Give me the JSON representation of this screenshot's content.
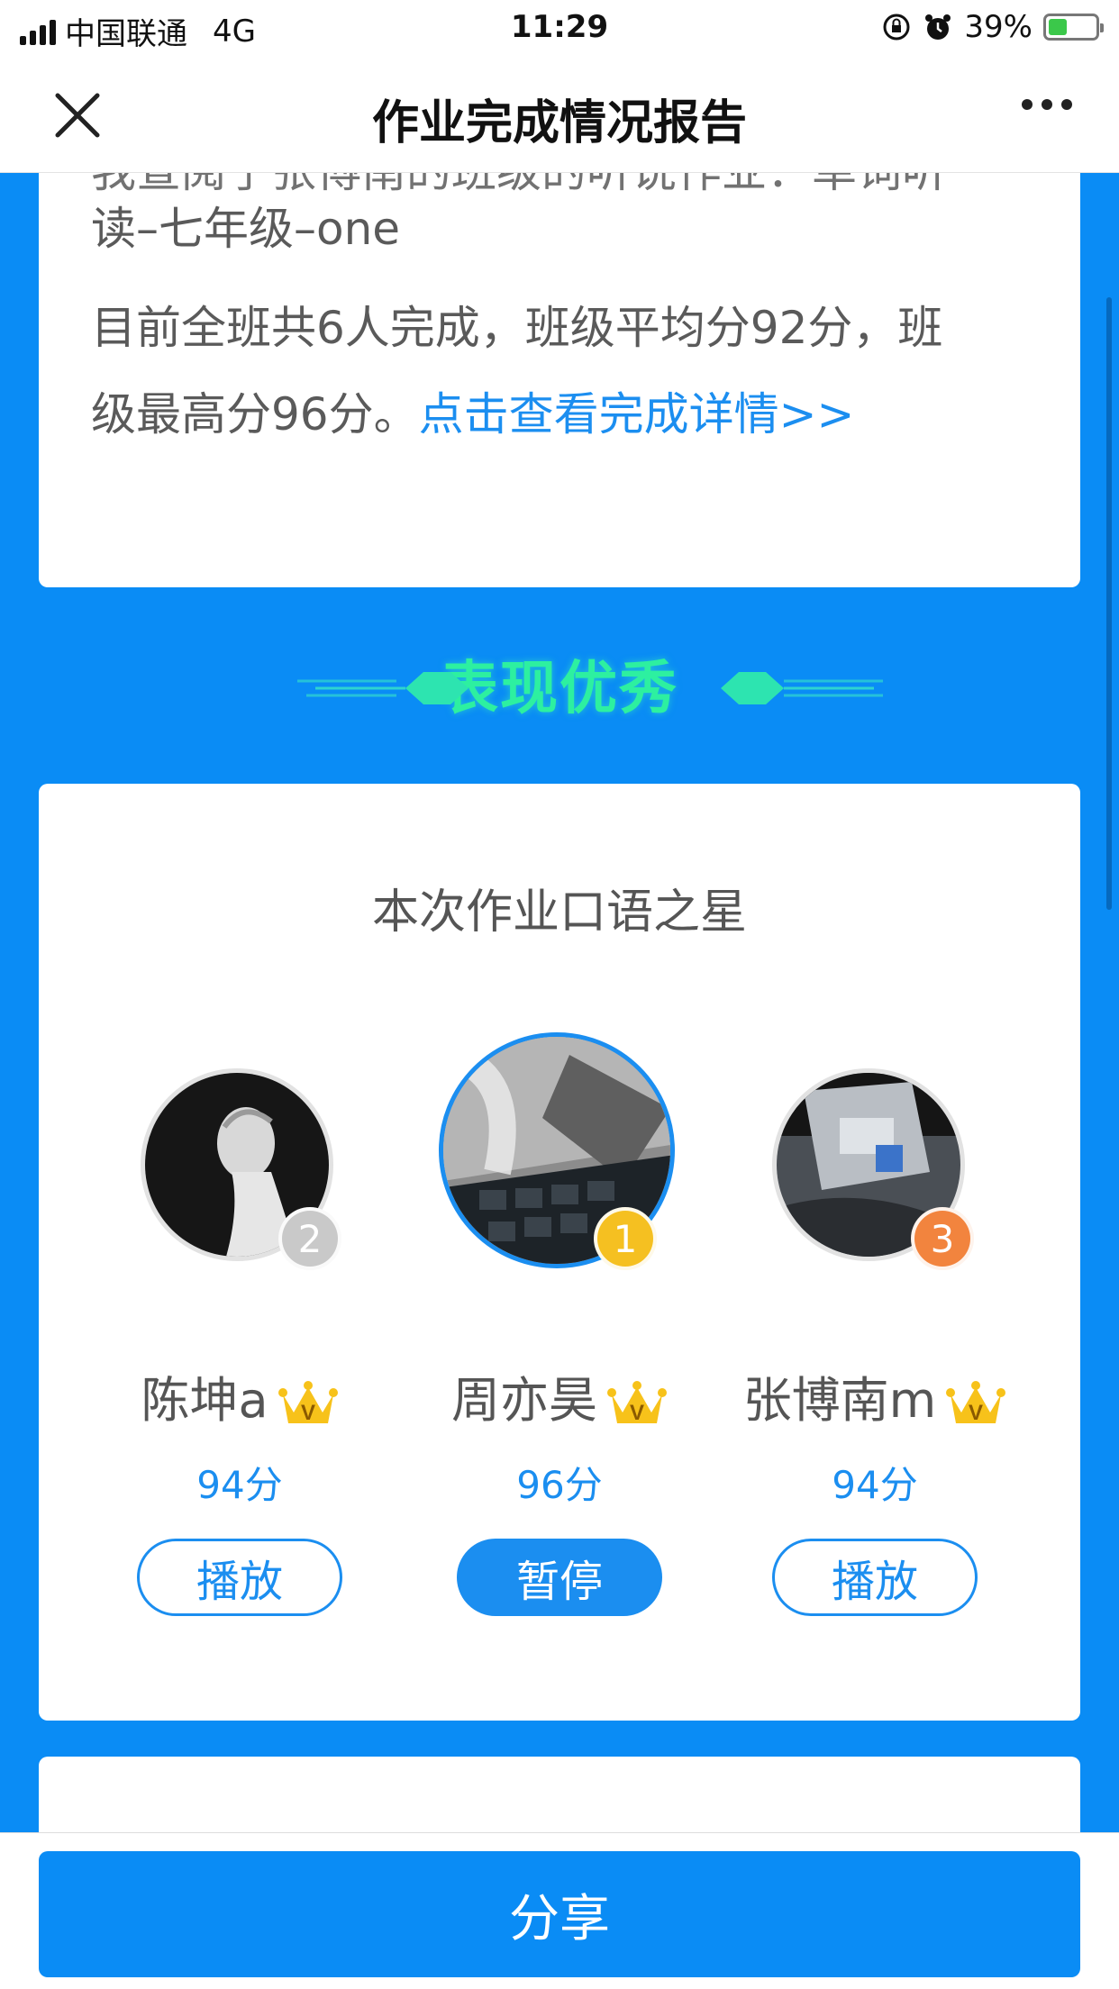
{
  "status_bar": {
    "carrier": "中国联通",
    "network": "4G",
    "time": "11:29",
    "battery": "39%",
    "battery_level": 0.39
  },
  "nav": {
    "title": "作业完成情况报告",
    "close_icon": "close-icon",
    "more_icon": "more-icon"
  },
  "summary": {
    "line1": "我查阅了张博南的班级的听说作业：单词听",
    "line2": "读–七年级–one",
    "line3": "目前全班共6人完成，班级平均分92分，班",
    "line4_prefix": "级最高分96分。",
    "link": "点击查看完成详情>>"
  },
  "banner": {
    "title": "表现优秀"
  },
  "stars": {
    "title": "本次作业口语之星",
    "items": [
      {
        "rank": "2",
        "name": "陈坤a",
        "score": "94分",
        "button": "播放",
        "rank_color": "#c9c9c9"
      },
      {
        "rank": "1",
        "name": "周亦昊",
        "score": "96分",
        "button": "暂停",
        "rank_color": "#f5c021"
      },
      {
        "rank": "3",
        "name": "张博南m",
        "score": "94分",
        "button": "播放",
        "rank_color": "#f2843e"
      }
    ]
  },
  "bottom": {
    "share": "分享"
  },
  "colors": {
    "primary": "#0a8cf5",
    "accent_green": "#2df0a0"
  }
}
